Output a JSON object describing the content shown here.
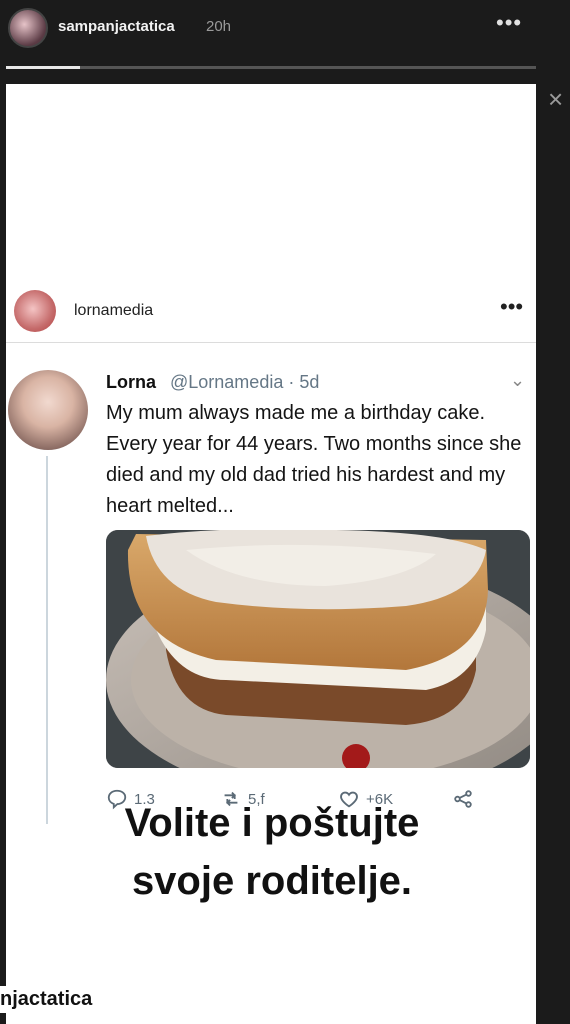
{
  "story": {
    "username": "sampanjactatica",
    "time": "20h",
    "more": "•••",
    "progress_fraction": 0.14,
    "close": "×"
  },
  "post": {
    "username": "lornamedia",
    "more": "•••"
  },
  "tweet": {
    "name": "Lorna",
    "handle_time": "@Lornamedia · 5d",
    "caret": "⌄",
    "text": "My mum always made me a birthday cake. Every year for 44 years. Two months since she died and my old dad tried his hardest and my heart melted...",
    "actions": {
      "replies": "1.3",
      "retweets": "5,f",
      "likes": "+6K"
    }
  },
  "caption": {
    "line1": "Volite i poštujte",
    "line2": "svoje roditelje."
  },
  "bottom_username": "njactatica",
  "colors": {
    "accent_text": "#657786",
    "background": "#1b1b1b",
    "card": "#ffffff"
  },
  "icons": [
    "ellipsis-icon",
    "close-icon",
    "reply-icon",
    "retweet-icon",
    "heart-icon",
    "share-icon",
    "chevron-down-icon"
  ]
}
